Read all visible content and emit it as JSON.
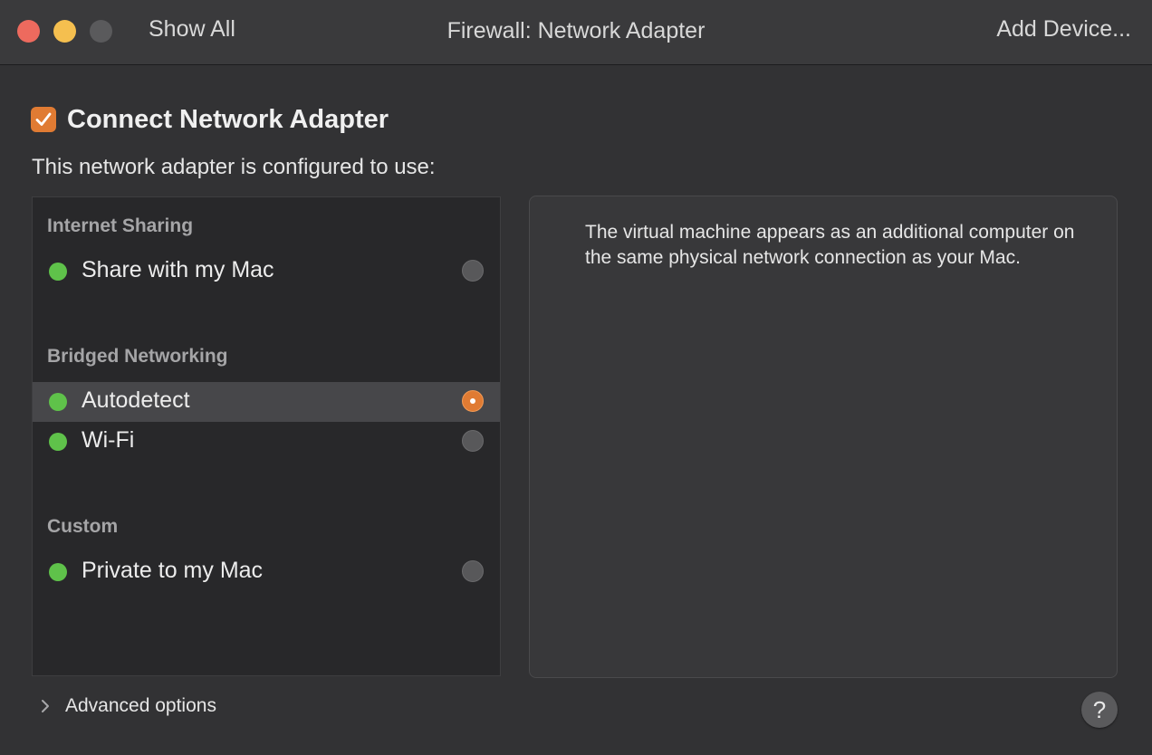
{
  "titlebar": {
    "show_all_label": "Show All",
    "title": "Firewall: Network Adapter",
    "add_device_label": "Add Device..."
  },
  "connect": {
    "checked": true,
    "label": "Connect Network Adapter"
  },
  "configured_text": "This network adapter is configured to use:",
  "sections": [
    {
      "header": "Internet Sharing",
      "options": [
        {
          "label": "Share with my Mac",
          "selected": false,
          "status": "green"
        }
      ]
    },
    {
      "header": "Bridged Networking",
      "options": [
        {
          "label": "Autodetect",
          "selected": true,
          "status": "green"
        },
        {
          "label": "Wi-Fi",
          "selected": false,
          "status": "green"
        }
      ]
    },
    {
      "header": "Custom",
      "options": [
        {
          "label": "Private to my Mac",
          "selected": false,
          "status": "green"
        }
      ]
    }
  ],
  "description": "The virtual machine appears as an additional computer on the same physical network connection as your Mac.",
  "advanced_label": "Advanced options",
  "help_label": "?",
  "colors": {
    "accent": "#e07b33",
    "status_green": "#5fc24a",
    "close": "#ed6a5e",
    "minimize": "#f5bf4f"
  },
  "icons": {
    "close": "close-icon",
    "minimize": "minimize-icon",
    "zoom": "zoom-icon",
    "checkbox": "checkmark-icon",
    "chevron": "chevron-right-icon",
    "help": "question-mark-icon"
  }
}
